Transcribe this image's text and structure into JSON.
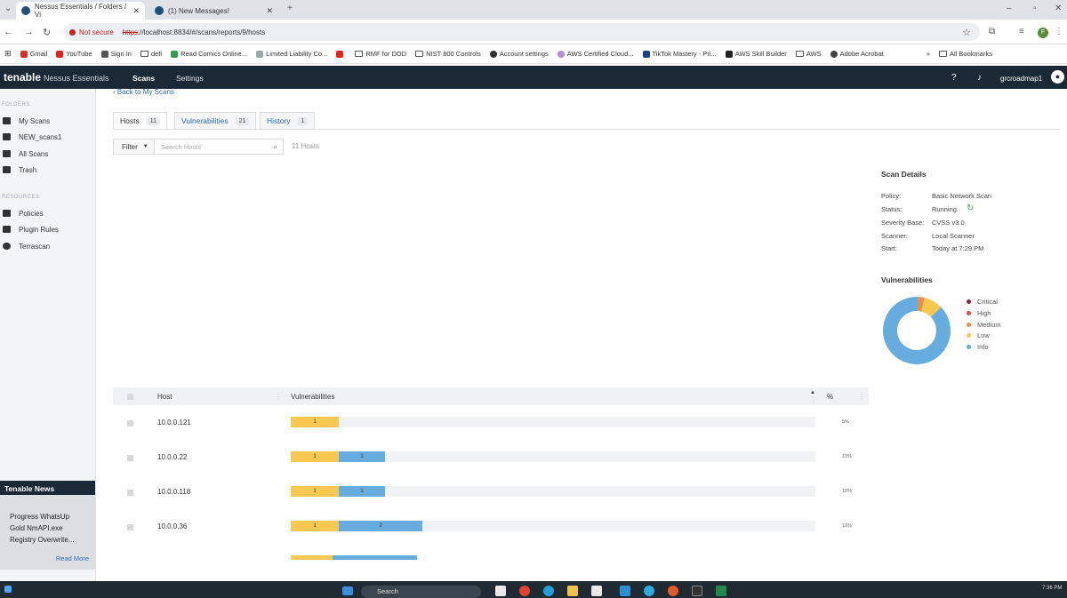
{
  "browser": {
    "tabs": [
      {
        "title": "Nessus Essentials / Folders / Vi",
        "active": true
      },
      {
        "title": "(1) New Messages!",
        "active": false
      }
    ],
    "not_secure": "Not secure",
    "url_scheme": "https",
    "url_rest": "://localhost:8834/#/scans/reports/9/hosts",
    "profile_initial": "F",
    "bookmarks": [
      "Gmail",
      "YouTube",
      "Sign In",
      "defi",
      "Read Comics Online...",
      "Limited Liability Co...",
      "RMF for DOD",
      "NIST 800 Controls",
      "Account settings",
      "AWS Certified Cloud...",
      "TikTok Mastery - Pri...",
      "AWS Skill Builder",
      "AWS",
      "Adobe Acrobat"
    ],
    "bookmarks_more": "»",
    "all_bookmarks": "All Bookmarks"
  },
  "app": {
    "logo": "tenable",
    "logo_sub": "Nessus Essentials",
    "nav": [
      "Scans",
      "Settings"
    ],
    "username": "grcroadmap1"
  },
  "sidebar": {
    "folders_heading": "FOLDERS",
    "folders": [
      "My Scans",
      "NEW_scans1",
      "All Scans",
      "Trash"
    ],
    "resources_heading": "RESOURCES",
    "resources": [
      "Policies",
      "Plugin Rules",
      "Terrascan"
    ],
    "news": {
      "title": "Tenable News",
      "lines": [
        "Progress WhatsUp",
        "Gold NmAPI.exe",
        "Registry Overwrite..."
      ],
      "more": "Read More"
    }
  },
  "main": {
    "back_link": "‹ Back to My Scans",
    "tabs": [
      {
        "label": "Hosts",
        "count": "11"
      },
      {
        "label": "Vulnerabilities",
        "count": "21"
      },
      {
        "label": "History",
        "count": "1"
      }
    ],
    "filter_label": "Filter",
    "search_placeholder": "Search Hosts",
    "host_count": "11 Hosts",
    "table": {
      "headers": [
        "Host",
        "Vulnerabilities",
        "%"
      ],
      "rows": [
        {
          "host": "10.0.0.121",
          "low": 1,
          "info": 0,
          "pct": "5%"
        },
        {
          "host": "10.0.0.22",
          "low": 1,
          "info": 1,
          "pct": "10%"
        },
        {
          "host": "10.0.0.118",
          "low": 1,
          "info": 1,
          "pct": "10%"
        },
        {
          "host": "10.0.0.36",
          "low": 1,
          "info": 2,
          "pct": "10%"
        }
      ]
    }
  },
  "details": {
    "title": "Scan Details",
    "fields": [
      {
        "label": "Policy:",
        "value": "Basic Network Scan"
      },
      {
        "label": "Status:",
        "value": "Running"
      },
      {
        "label": "Severity Base:",
        "value": "CVSS v3.0"
      },
      {
        "label": "Scanner:",
        "value": "Local Scanner"
      },
      {
        "label": "Start:",
        "value": "Today at 7:29 PM"
      }
    ]
  },
  "vulnerabilities": {
    "title": "Vulnerabilities",
    "legend": [
      {
        "label": "Critical",
        "color": "#91243e"
      },
      {
        "label": "High",
        "color": "#dd4b50"
      },
      {
        "label": "Medium",
        "color": "#f18c43"
      },
      {
        "label": "Low",
        "color": "#f8c851"
      },
      {
        "label": "Info",
        "color": "#67acdf"
      }
    ],
    "donut_fractions": {
      "Critical": 0,
      "High": 0,
      "Medium": 0.03,
      "Low": 0.09,
      "Info": 0.88
    }
  },
  "taskbar": {
    "search": "Search",
    "clock": "7:36 PM"
  },
  "colors": {
    "nav_bg": "#1b2836",
    "low": "#f8c851",
    "info": "#67acdf",
    "link": "#2b6cb0"
  }
}
